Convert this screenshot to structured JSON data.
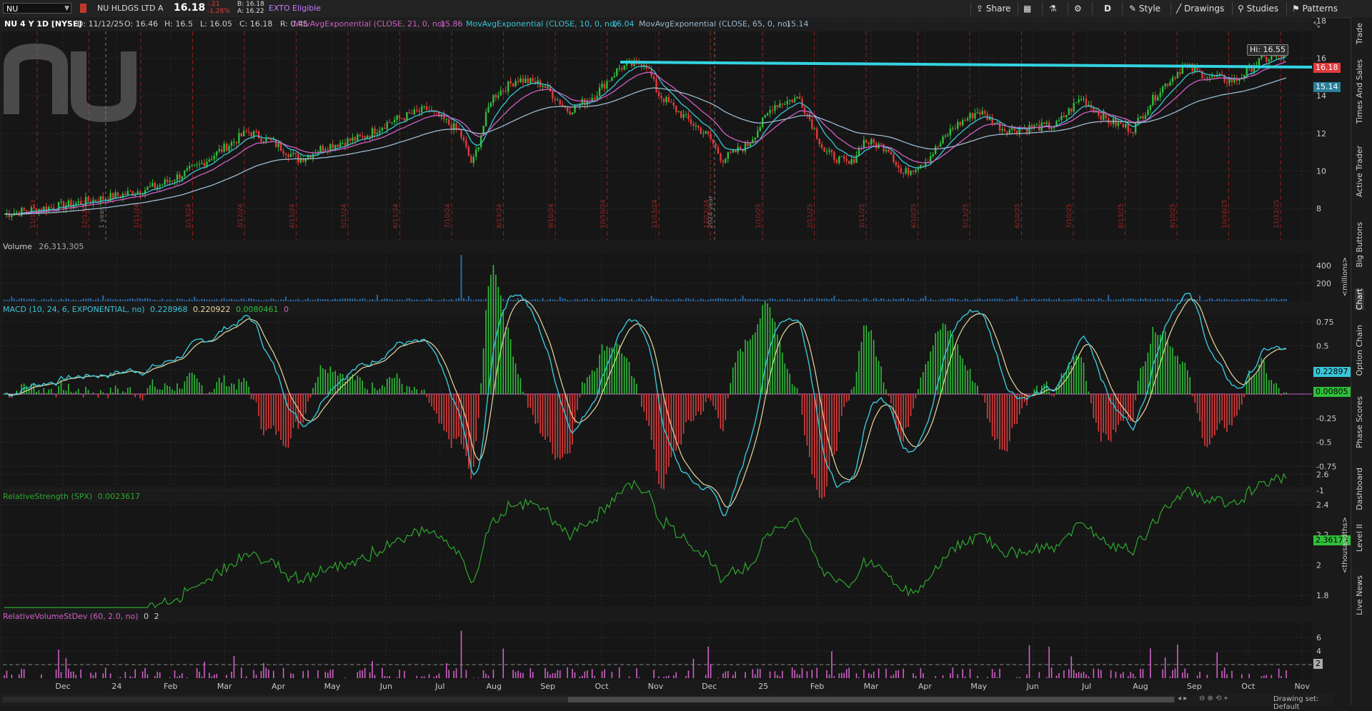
{
  "toolbar": {
    "symbol": "NU",
    "company": "NU HLDGS LTD A",
    "last": "16.18",
    "change": "-.21",
    "change_pct": "-1.28%",
    "bid": "B: 16.18",
    "ask": "A: 16.22",
    "exto": "EXTO Eligible",
    "share": "Share",
    "period": "D",
    "style": "Style",
    "drawings": "Drawings",
    "studies": "Studies",
    "patterns": "Patterns"
  },
  "infobar": {
    "title": "NU 4 Y 1D [NYSE]",
    "date": "D: 11/12/25",
    "open": "O: 16.46",
    "high": "H: 16.5",
    "low": "L: 16.05",
    "close": "C: 16.18",
    "range": "R: 0.45",
    "ema21_label": "MovAvgExponential (CLOSE, 21, 0, no)",
    "ema21_value": "15.86",
    "ema10_label": "MovAvgExponential (CLOSE, 10, 0, no)",
    "ema10_value": "16.04",
    "ema65_label": "MovAvgExponential (CLOSE, 65, 0, no)",
    "ema65_value": "15.14"
  },
  "colors": {
    "up": "#2fbf3a",
    "down": "#e03c3c",
    "ema10": "#39c6d8",
    "ema21": "#d060c8",
    "ema65": "#9bbad0",
    "trendline": "#33d3e0",
    "rs_line": "#2ea82e",
    "rvol": "#d060c8"
  },
  "price_panel": {
    "hi_label": "Hi: 16.55",
    "last_badge": "16.18",
    "ema65_badge": "15.14",
    "y_ticks": [
      "18",
      "16",
      "14",
      "12",
      "10",
      "8"
    ],
    "earnings_dates": [
      "11/14/23",
      "12/12/23",
      "1/11/24",
      "2/13/24",
      "3/12/24",
      "4/11/24",
      "5/13/24",
      "6/11/24",
      "7/10/24",
      "8/13/24",
      "9/10/24",
      "10/10/24",
      "11/13/24",
      "12/12/24",
      "1/10/25",
      "2/11/25",
      "3/11/25",
      "4/10/25",
      "5/13/25",
      "6/10/25",
      "7/10/25",
      "8/13/25",
      "9/10/25",
      "10/10/25",
      "11/12/25"
    ],
    "year_labels": [
      "1 year",
      "2024 year"
    ]
  },
  "volume_panel": {
    "label": "Volume",
    "value": "26,313,305",
    "y_ticks": [
      "400",
      "200"
    ],
    "unit": "<millions>"
  },
  "macd_panel": {
    "label": "MACD (10, 24, 6, EXPONENTIAL, no)",
    "v1": "0.228968",
    "v2": "0.220922",
    "v3": "0.0080461",
    "v4": "0",
    "y_ticks": [
      "0.75",
      "0.5",
      "0.25",
      "-0.25",
      "-0.5",
      "-0.75",
      "-1"
    ],
    "badge1": "0.22897",
    "badge2": "0.00805"
  },
  "rs_panel": {
    "label": "RelativeStrength (SPX)",
    "value": "0.0023617",
    "y_ticks": [
      "2.6",
      "2.4",
      "2.2",
      "2",
      "1.8"
    ],
    "badge": "2.36173",
    "unit": "<thousandths>"
  },
  "rvol_panel": {
    "label": "RelativeVolumeStDev (60, 2.0, no)",
    "v1": "0",
    "v2": "2",
    "y_ticks": [
      "6",
      "4",
      "2"
    ],
    "badge": "2"
  },
  "x_axis": {
    "months": [
      "Dec",
      "24",
      "Feb",
      "Mar",
      "Apr",
      "May",
      "Jun",
      "Jul",
      "Aug",
      "Sep",
      "Oct",
      "Nov",
      "Dec",
      "25",
      "Feb",
      "Mar",
      "Apr",
      "May",
      "Jun",
      "Jul",
      "Aug",
      "Sep",
      "Oct",
      "Nov"
    ]
  },
  "right_tabs": [
    "Trade",
    "Times And Sales",
    "Active Trader",
    "Big Buttons",
    "Chart",
    "Option Chain",
    "Phase Scores",
    "Dashboard",
    "Level II",
    "Live News"
  ],
  "status": {
    "drawing_set": "Drawing set: Default"
  }
}
